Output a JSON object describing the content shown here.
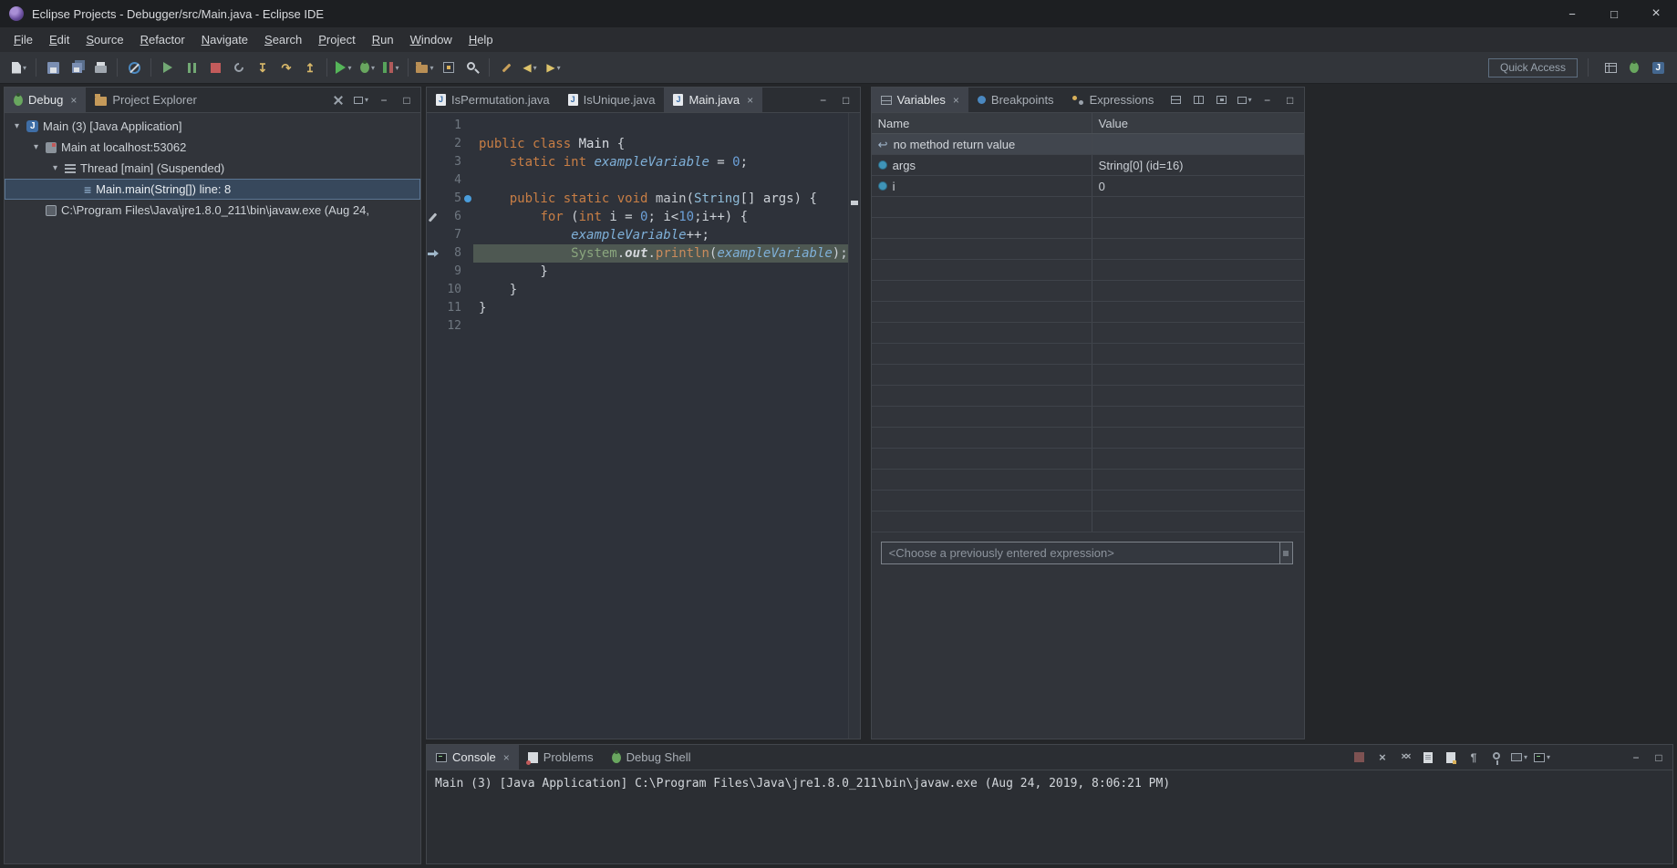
{
  "window": {
    "title": "Eclipse Projects - Debugger/src/Main.java - Eclipse IDE"
  },
  "menu": {
    "items": [
      "File",
      "Edit",
      "Source",
      "Refactor",
      "Navigate",
      "Search",
      "Project",
      "Run",
      "Window",
      "Help"
    ]
  },
  "toolbar": {
    "quick_access_label": "Quick Access",
    "items": [
      {
        "name": "new-wizard-button",
        "icon": "new-wizard",
        "dropdown": true
      },
      {
        "sep": true
      },
      {
        "name": "save-button",
        "icon": "save"
      },
      {
        "name": "save-all-button",
        "icon": "save-all"
      },
      {
        "name": "print-button",
        "icon": "print"
      },
      {
        "sep": true
      },
      {
        "name": "skip-breakpoints-button",
        "icon": "skip-breakpoints"
      },
      {
        "sep": true
      },
      {
        "name": "resume-button",
        "icon": "resume"
      },
      {
        "name": "suspend-button",
        "icon": "suspend"
      },
      {
        "name": "terminate-button",
        "icon": "terminate"
      },
      {
        "name": "disconnect-button",
        "icon": "disconnect"
      },
      {
        "name": "step-into-button",
        "icon": "step-into"
      },
      {
        "name": "step-over-button",
        "icon": "step-over"
      },
      {
        "name": "step-return-button",
        "icon": "step-return"
      },
      {
        "sep": true
      },
      {
        "name": "run-button",
        "icon": "run",
        "dropdown": true
      },
      {
        "name": "debug-button",
        "icon": "bug",
        "dropdown": true
      },
      {
        "name": "coverage-button",
        "icon": "coverage",
        "dropdown": true
      },
      {
        "sep": true
      },
      {
        "name": "new-java-project-button",
        "icon": "new-project",
        "dropdown": true
      },
      {
        "name": "open-type-button",
        "icon": "open-type"
      },
      {
        "name": "search-button",
        "icon": "search"
      },
      {
        "sep": true
      },
      {
        "name": "last-edit-location-button",
        "icon": "last-edit"
      },
      {
        "name": "back-button",
        "icon": "back",
        "dropdown": true
      },
      {
        "name": "forward-button",
        "icon": "forward",
        "dropdown": true
      }
    ],
    "right_items": [
      {
        "name": "open-perspective-button",
        "icon": "open-perspective"
      },
      {
        "name": "debug-perspective-button",
        "icon": "bug",
        "active": true
      },
      {
        "name": "java-perspective-button",
        "icon": "java-perspective"
      }
    ]
  },
  "debug_panel": {
    "tabs": [
      {
        "label": "Debug",
        "icon": "bug",
        "active": true,
        "closable": true
      },
      {
        "label": "Project Explorer",
        "icon": "folder"
      }
    ],
    "toolbar": [
      {
        "name": "collapse-all-button",
        "icon": "tools"
      },
      {
        "name": "view-menu-button",
        "icon": "view-menu",
        "dropdown": true
      }
    ],
    "tree": [
      {
        "label": "Main (3) [Java Application]",
        "indent": 0,
        "expanded": true,
        "icon": "java-app"
      },
      {
        "label": "Main at localhost:53062",
        "indent": 1,
        "expanded": true,
        "icon": "jvm"
      },
      {
        "label": "Thread [main] (Suspended)",
        "indent": 2,
        "expanded": true,
        "icon": "thread"
      },
      {
        "label": "Main.main(String[]) line: 8",
        "indent": 3,
        "icon": "stack-frame",
        "selected": true
      },
      {
        "label": "C:\\Program Files\\Java\\jre1.8.0_211\\bin\\javaw.exe (Aug 24,",
        "indent": 1,
        "icon": "process"
      }
    ]
  },
  "editor": {
    "tabs": [
      {
        "label": "IsPermutation.java",
        "icon": "java-file"
      },
      {
        "label": "IsUnique.java",
        "icon": "java-file"
      },
      {
        "label": "Main.java",
        "icon": "java-file",
        "active": true,
        "closable": true
      }
    ],
    "lines": [
      {
        "n": "1",
        "tokens": []
      },
      {
        "n": "2",
        "tokens": [
          {
            "t": "public class ",
            "c": "kw"
          },
          {
            "t": "Main",
            "c": "typedecl"
          },
          {
            "t": " {",
            "c": "pl"
          }
        ]
      },
      {
        "n": "3",
        "tokens": [
          {
            "t": "    ",
            "c": "pl"
          },
          {
            "t": "static int ",
            "c": "kw"
          },
          {
            "t": "exampleVariable",
            "c": "field"
          },
          {
            "t": " = ",
            "c": "pl"
          },
          {
            "t": "0",
            "c": "num"
          },
          {
            "t": ";",
            "c": "pl"
          }
        ]
      },
      {
        "n": "4",
        "tokens": []
      },
      {
        "n": "5",
        "marker": "breakpoint",
        "tokens": [
          {
            "t": "    ",
            "c": "pl"
          },
          {
            "t": "public static void ",
            "c": "kw"
          },
          {
            "t": "main",
            "c": "methoddecl"
          },
          {
            "t": "(",
            "c": "pl"
          },
          {
            "t": "String",
            "c": "type"
          },
          {
            "t": "[] args) {",
            "c": "pl"
          }
        ]
      },
      {
        "n": "6",
        "marker": "pen",
        "tokens": [
          {
            "t": "        ",
            "c": "pl"
          },
          {
            "t": "for",
            "c": "kw"
          },
          {
            "t": " (",
            "c": "pl"
          },
          {
            "t": "int",
            "c": "kw"
          },
          {
            "t": " i = ",
            "c": "pl"
          },
          {
            "t": "0",
            "c": "num"
          },
          {
            "t": "; i<",
            "c": "pl"
          },
          {
            "t": "10",
            "c": "num"
          },
          {
            "t": ";i++) {",
            "c": "pl"
          }
        ]
      },
      {
        "n": "7",
        "tokens": [
          {
            "t": "            ",
            "c": "pl"
          },
          {
            "t": "exampleVariable",
            "c": "field"
          },
          {
            "t": "++;",
            "c": "pl"
          }
        ]
      },
      {
        "n": "8",
        "current": true,
        "marker": "arrow",
        "tokens": [
          {
            "t": "            ",
            "c": "pl"
          },
          {
            "t": "System",
            "c": "cls2"
          },
          {
            "t": ".",
            "c": "pl"
          },
          {
            "t": "out",
            "c": "staticfield"
          },
          {
            "t": ".",
            "c": "pl"
          },
          {
            "t": "println",
            "c": "method"
          },
          {
            "t": "(",
            "c": "pl"
          },
          {
            "t": "exampleVariable",
            "c": "field"
          },
          {
            "t": ");",
            "c": "pl"
          }
        ]
      },
      {
        "n": "9",
        "tokens": [
          {
            "t": "        }",
            "c": "pl"
          }
        ]
      },
      {
        "n": "10",
        "tokens": [
          {
            "t": "    }",
            "c": "pl"
          }
        ]
      },
      {
        "n": "11",
        "tokens": [
          {
            "t": "}",
            "c": "pl"
          }
        ]
      },
      {
        "n": "12",
        "tokens": []
      }
    ]
  },
  "variables_panel": {
    "tabs": [
      {
        "label": "Variables",
        "icon": "variables-view",
        "active": true,
        "closable": true
      },
      {
        "label": "Breakpoints",
        "icon": "breakpoint"
      },
      {
        "label": "Expressions",
        "icon": "expressions-view"
      }
    ],
    "toolbar": [
      {
        "name": "show-type-names-button",
        "icon": "grid1"
      },
      {
        "name": "show-logical-structures-button",
        "icon": "grid2"
      },
      {
        "name": "collapse-all-button",
        "icon": "grid3"
      },
      {
        "name": "view-menu-button",
        "icon": "view-menu",
        "dropdown": true
      }
    ],
    "columns": [
      "Name",
      "Value"
    ],
    "rows": [
      {
        "icon": "return-value",
        "name": "no method return value",
        "value": "",
        "highlight": true
      },
      {
        "icon": "variable",
        "name": "args",
        "value": "String[0]  (id=16)"
      },
      {
        "icon": "variable",
        "name": "i",
        "value": "0"
      }
    ],
    "empty_rows": 16,
    "expression_placeholder": "<Choose a previously entered expression>"
  },
  "console_panel": {
    "tabs": [
      {
        "label": "Console",
        "icon": "console-view",
        "active": true,
        "closable": true
      },
      {
        "label": "Problems",
        "icon": "problems-view"
      },
      {
        "label": "Debug Shell",
        "icon": "bug"
      }
    ],
    "toolbar": [
      {
        "name": "terminate-console-button",
        "icon": "terminate-dim"
      },
      {
        "name": "remove-launch-button",
        "icon": "remove-launch"
      },
      {
        "name": "remove-all-launches-button",
        "icon": "remove-all"
      },
      {
        "name": "clear-console-button",
        "icon": "clear"
      },
      {
        "name": "scroll-lock-button",
        "icon": "scroll-lock"
      },
      {
        "name": "word-wrap-button",
        "icon": "word-wrap"
      },
      {
        "name": "pin-console-button",
        "icon": "pin"
      },
      {
        "name": "display-selected-console-button",
        "icon": "display",
        "dropdown": true
      },
      {
        "name": "open-console-button",
        "icon": "open-console",
        "dropdown": true
      }
    ],
    "text": "Main (3) [Java Application] C:\\Program Files\\Java\\jre1.8.0_211\\bin\\javaw.exe (Aug 24, 2019, 8:06:21 PM)"
  }
}
